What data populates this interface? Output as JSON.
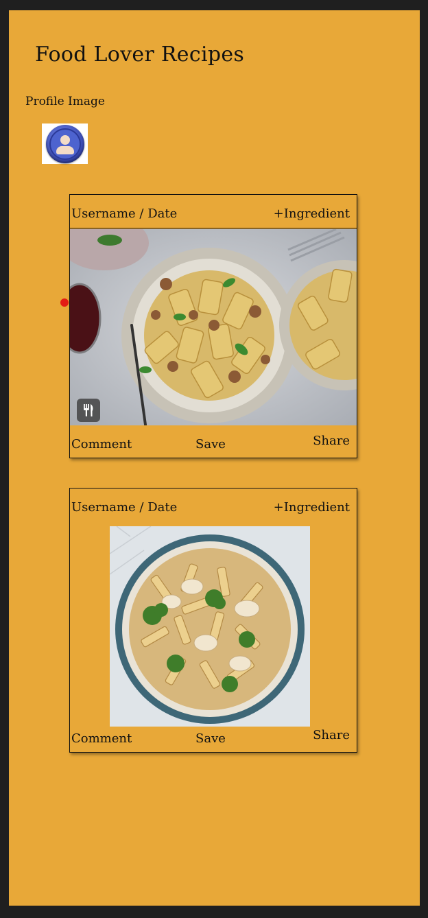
{
  "app": {
    "title": "Food Lover Recipes"
  },
  "profile": {
    "label": "Profile Image",
    "avatar_icon": "user-avatar-icon"
  },
  "posts": [
    {
      "user_date": "Username /  Date",
      "ingredient": "+Ingredient",
      "image_icon": "fork-knife-icon",
      "comment": "Comment",
      "save": "Save",
      "share": "Share"
    },
    {
      "user_date": "Username /  Date",
      "ingredient": "+Ingredient",
      "comment": "Comment",
      "save": "Save",
      "share": "Share"
    }
  ],
  "colors": {
    "background": "#e8a838",
    "frame": "#1f1f1f",
    "marker": "#e31b14"
  }
}
